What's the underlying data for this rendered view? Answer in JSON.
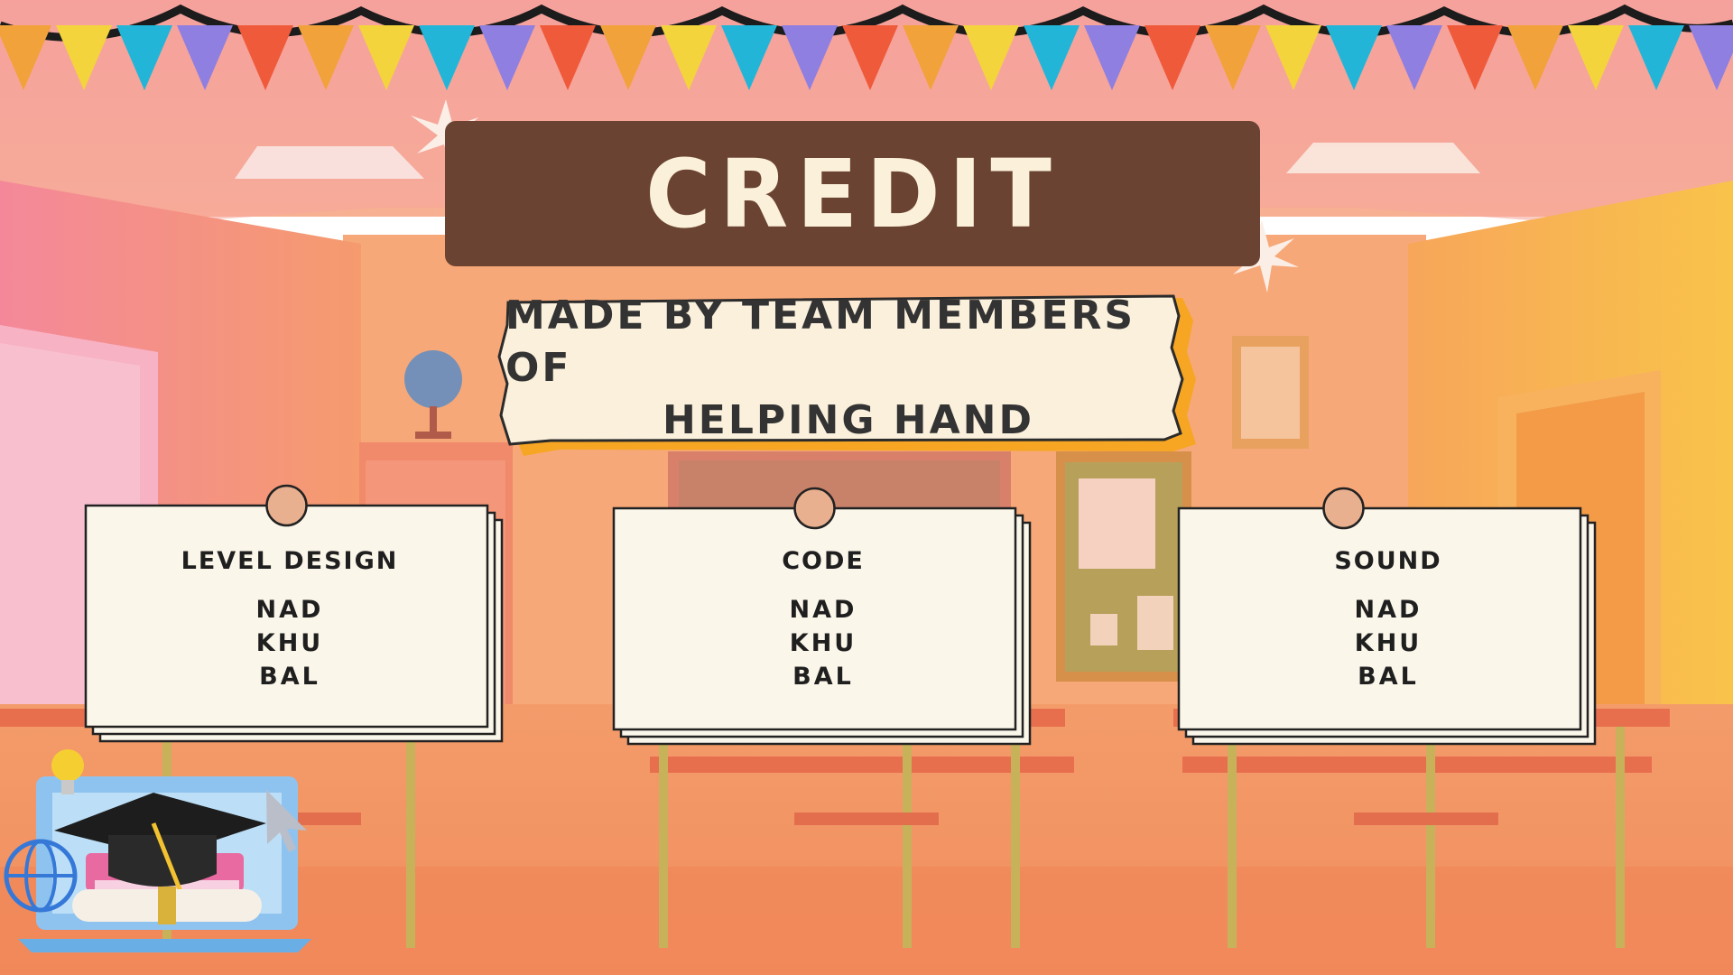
{
  "title": "CREDIT",
  "subtitle": {
    "line1": "MADE BY TEAM MEMBERS OF",
    "line2": "HELPING HAND"
  },
  "cards": [
    {
      "heading": "LEVEL DESIGN",
      "names": [
        "NAD",
        "KHU",
        "BAL"
      ]
    },
    {
      "heading": "CODE",
      "names": [
        "NAD",
        "KHU",
        "BAL"
      ]
    },
    {
      "heading": "SOUND",
      "names": [
        "NAD",
        "KHU",
        "BAL"
      ]
    }
  ],
  "colors": {
    "title_box": "#6b4332",
    "title_text": "#fbf1da",
    "paper": "#fbf6ea",
    "pin": "#e8b08f",
    "accent_orange": "#f6a623",
    "bunting": [
      "#f2a23a",
      "#f4d43c",
      "#23b5d8",
      "#8f7fe0",
      "#ef5a3a"
    ]
  },
  "decorations": {
    "bunting": "flag-bunting",
    "stars": "sparkle-star-icon",
    "corner_icon": "graduation-laptop-icon"
  }
}
